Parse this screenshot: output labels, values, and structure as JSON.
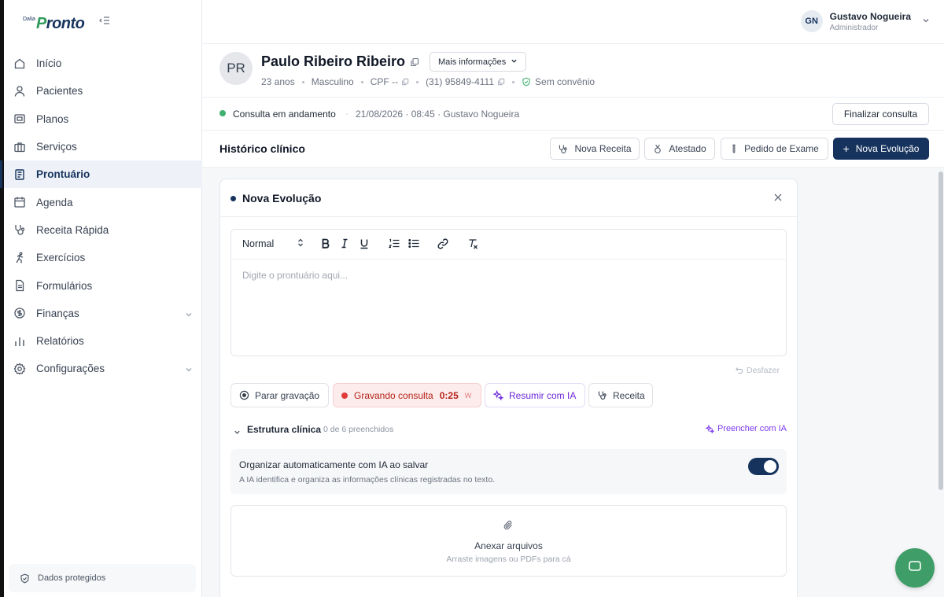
{
  "brand": {
    "prefix": "Dalia",
    "name_first": "P",
    "name_rest": "ronto"
  },
  "sidebar": {
    "items": [
      {
        "label": "Início",
        "icon": "home-icon"
      },
      {
        "label": "Pacientes",
        "icon": "user-icon"
      },
      {
        "label": "Planos",
        "icon": "card-icon"
      },
      {
        "label": "Serviços",
        "icon": "briefcase-icon"
      },
      {
        "label": "Prontuário",
        "icon": "record-icon",
        "active": true
      },
      {
        "label": "Agenda",
        "icon": "calendar-icon"
      },
      {
        "label": "Receita Rápida",
        "icon": "stethoscope-icon"
      },
      {
        "label": "Exercícios",
        "icon": "running-icon"
      },
      {
        "label": "Formulários",
        "icon": "document-icon"
      },
      {
        "label": "Finanças",
        "icon": "money-icon",
        "expandable": true
      },
      {
        "label": "Relatórios",
        "icon": "bar-chart-icon"
      },
      {
        "label": "Configurações",
        "icon": "gear-icon",
        "expandable": true
      }
    ],
    "footer": "Dados protegidos"
  },
  "user": {
    "initials": "GN",
    "name": "Gustavo Nogueira",
    "role": "Administrador"
  },
  "patient": {
    "initials": "PR",
    "name": "Paulo Ribeiro Ribeiro",
    "more_label": "Mais informações",
    "age": "23 anos",
    "sex": "Masculino",
    "cpf": "CPF --",
    "phone": "(31) 95849-4111",
    "insurance": "Sem convênio"
  },
  "consultation": {
    "status": "Consulta em andamento",
    "separator": "·",
    "info": "21/08/2026 · 08:45 · Gustavo Nogueira",
    "finalize_label": "Finalizar consulta",
    "status_color": "#3fb06f"
  },
  "history": {
    "title": "Histórico clínico",
    "buttons": {
      "receita": "Nova Receita",
      "atestado": "Atestado",
      "exame": "Pedido de Exame",
      "evolucao": "Nova Evolução"
    }
  },
  "evolution": {
    "title": "Nova Evolução",
    "format_select": "Normal",
    "placeholder": "Digite o prontuário aqui...",
    "undo_label": "Desfazer",
    "actions": {
      "stop": "Parar gravação",
      "recording": "Gravando consulta",
      "timer": "0:25",
      "rec_suffix": "W",
      "summarize": "Resumir com IA",
      "prescription": "Receita"
    },
    "structure": {
      "title": "Estrutura clínica",
      "count": "0 de 6 preenchidos",
      "fill_ai": "Preencher com IA"
    },
    "organize": {
      "title": "Organizar automaticamente com IA ao salvar",
      "description": "A IA identifica e organiza as informações clínicas registradas no texto.",
      "enabled": true
    },
    "attach": {
      "title": "Anexar arquivos",
      "subtitle": "Arraste imagens ou PDFs para cá"
    }
  },
  "colors": {
    "primary": "#16335e",
    "success": "#3fb06f",
    "recording": "#e03b3b",
    "ai": "#7c3aed"
  }
}
